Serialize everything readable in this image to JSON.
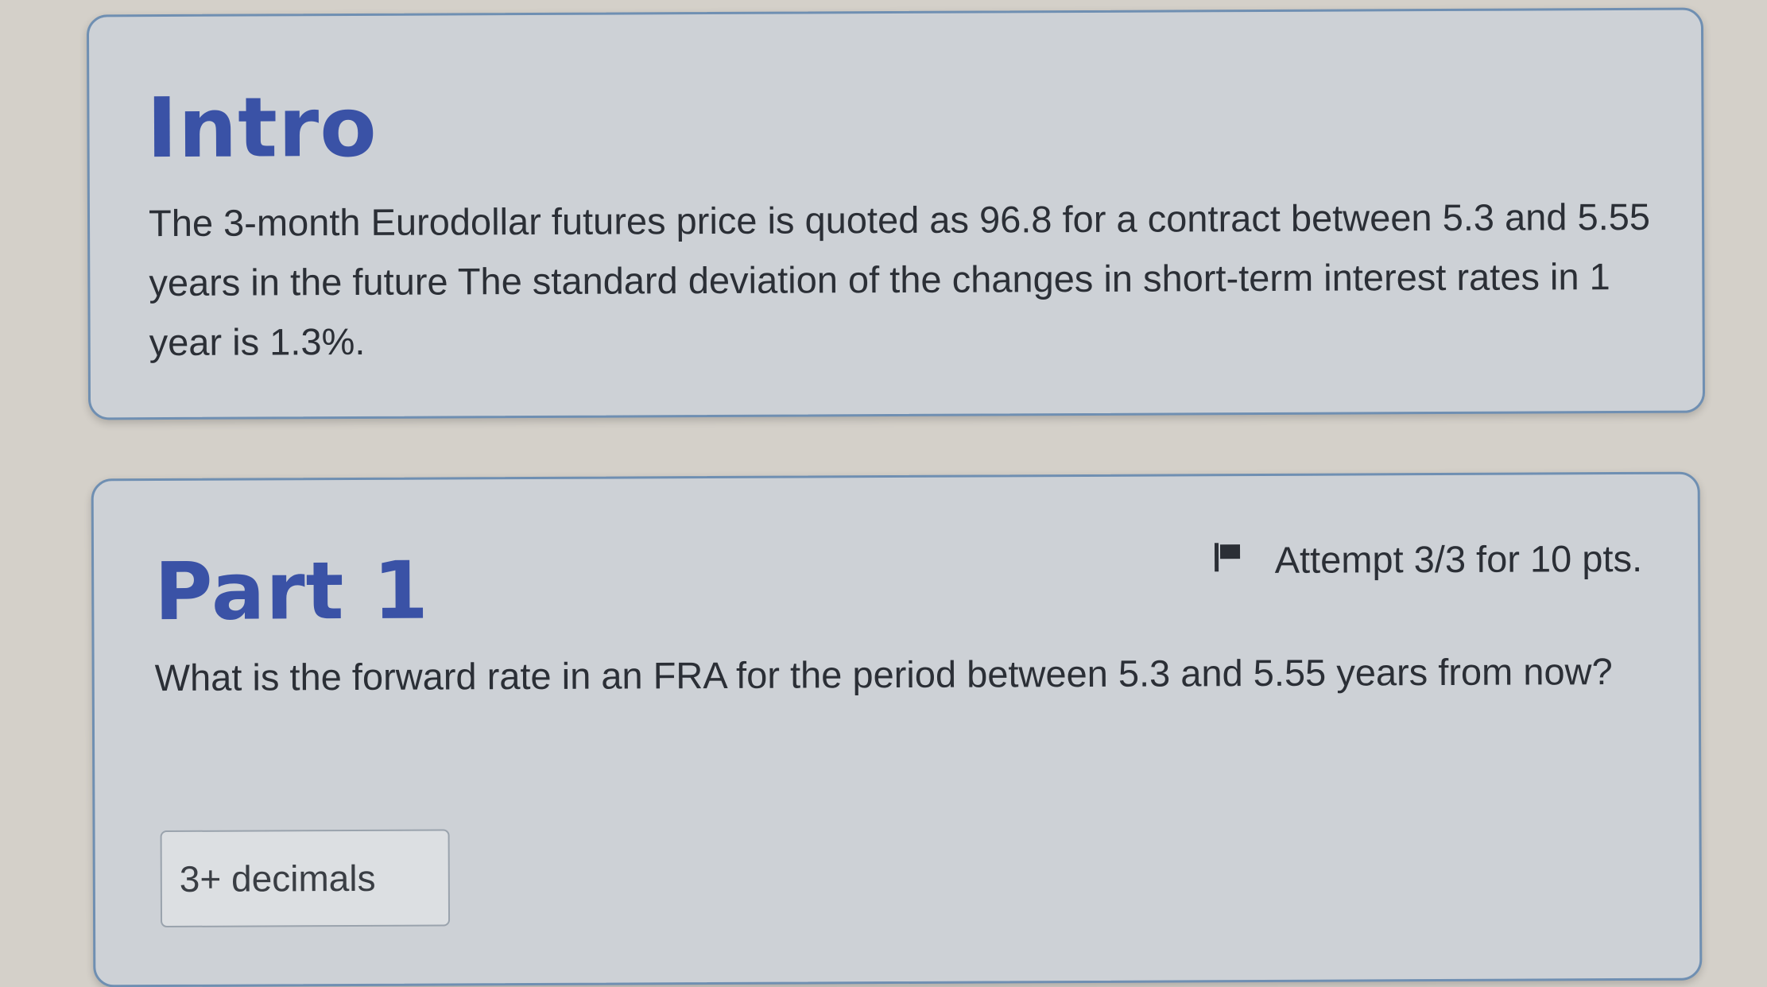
{
  "intro": {
    "title": "Intro",
    "text": "The 3-month Eurodollar futures price is quoted as 96.8 for a contract between 5.3 and 5.55 years in the future The standard deviation of the changes in short-term interest rates in 1 year is 1.3%."
  },
  "part1": {
    "title": "Part 1",
    "attempt_label": "Attempt 3/3 for 10 pts.",
    "question": "What is the forward rate in an FRA for the period between 5.3 and 5.55 years from now?",
    "answer_placeholder": "3+ decimals",
    "answer_value": ""
  },
  "icons": {
    "attempt_flag": "flag-icon"
  },
  "colors": {
    "heading": "#3a52a6",
    "card_border": "#6f8fb2",
    "card_background": "#cdd1d6"
  }
}
